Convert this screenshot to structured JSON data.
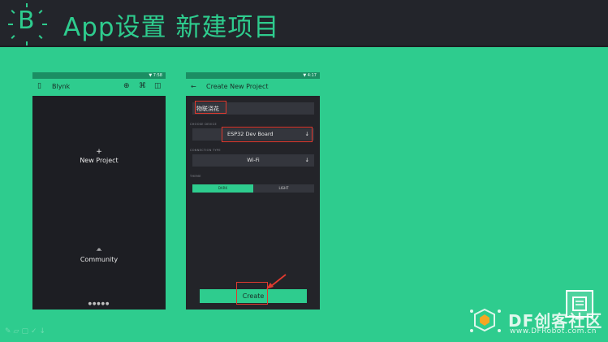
{
  "header": {
    "logo_letter": "B",
    "title": "App设置 新建项目"
  },
  "phone1": {
    "status_time": "▼ 7:58",
    "app_title": "Blynk",
    "new_project_plus": "+",
    "new_project_label": "New Project",
    "community_label": "Community",
    "page_dots": "●●●●●"
  },
  "phone2": {
    "status_time": "▼ 4:17",
    "back_icon": "←",
    "title": "Create New Project",
    "project_name_value": "物联浇花",
    "choose_device_label": "CHOOSE DEVICE",
    "device_value": "ESP32 Dev Board",
    "connection_label": "CONNECTION TYPE",
    "connection_value": "Wi-Fi",
    "theme_label": "THEME",
    "theme_dark": "DARK",
    "theme_light": "LIGHT",
    "create_label": "Create"
  },
  "watermark": {
    "brand": "DF创客社区",
    "url": "www.DFRobot.com.cn"
  },
  "colors": {
    "accent": "#2ecc8e",
    "header_bg": "#23252b",
    "highlight": "#e03a2f"
  }
}
